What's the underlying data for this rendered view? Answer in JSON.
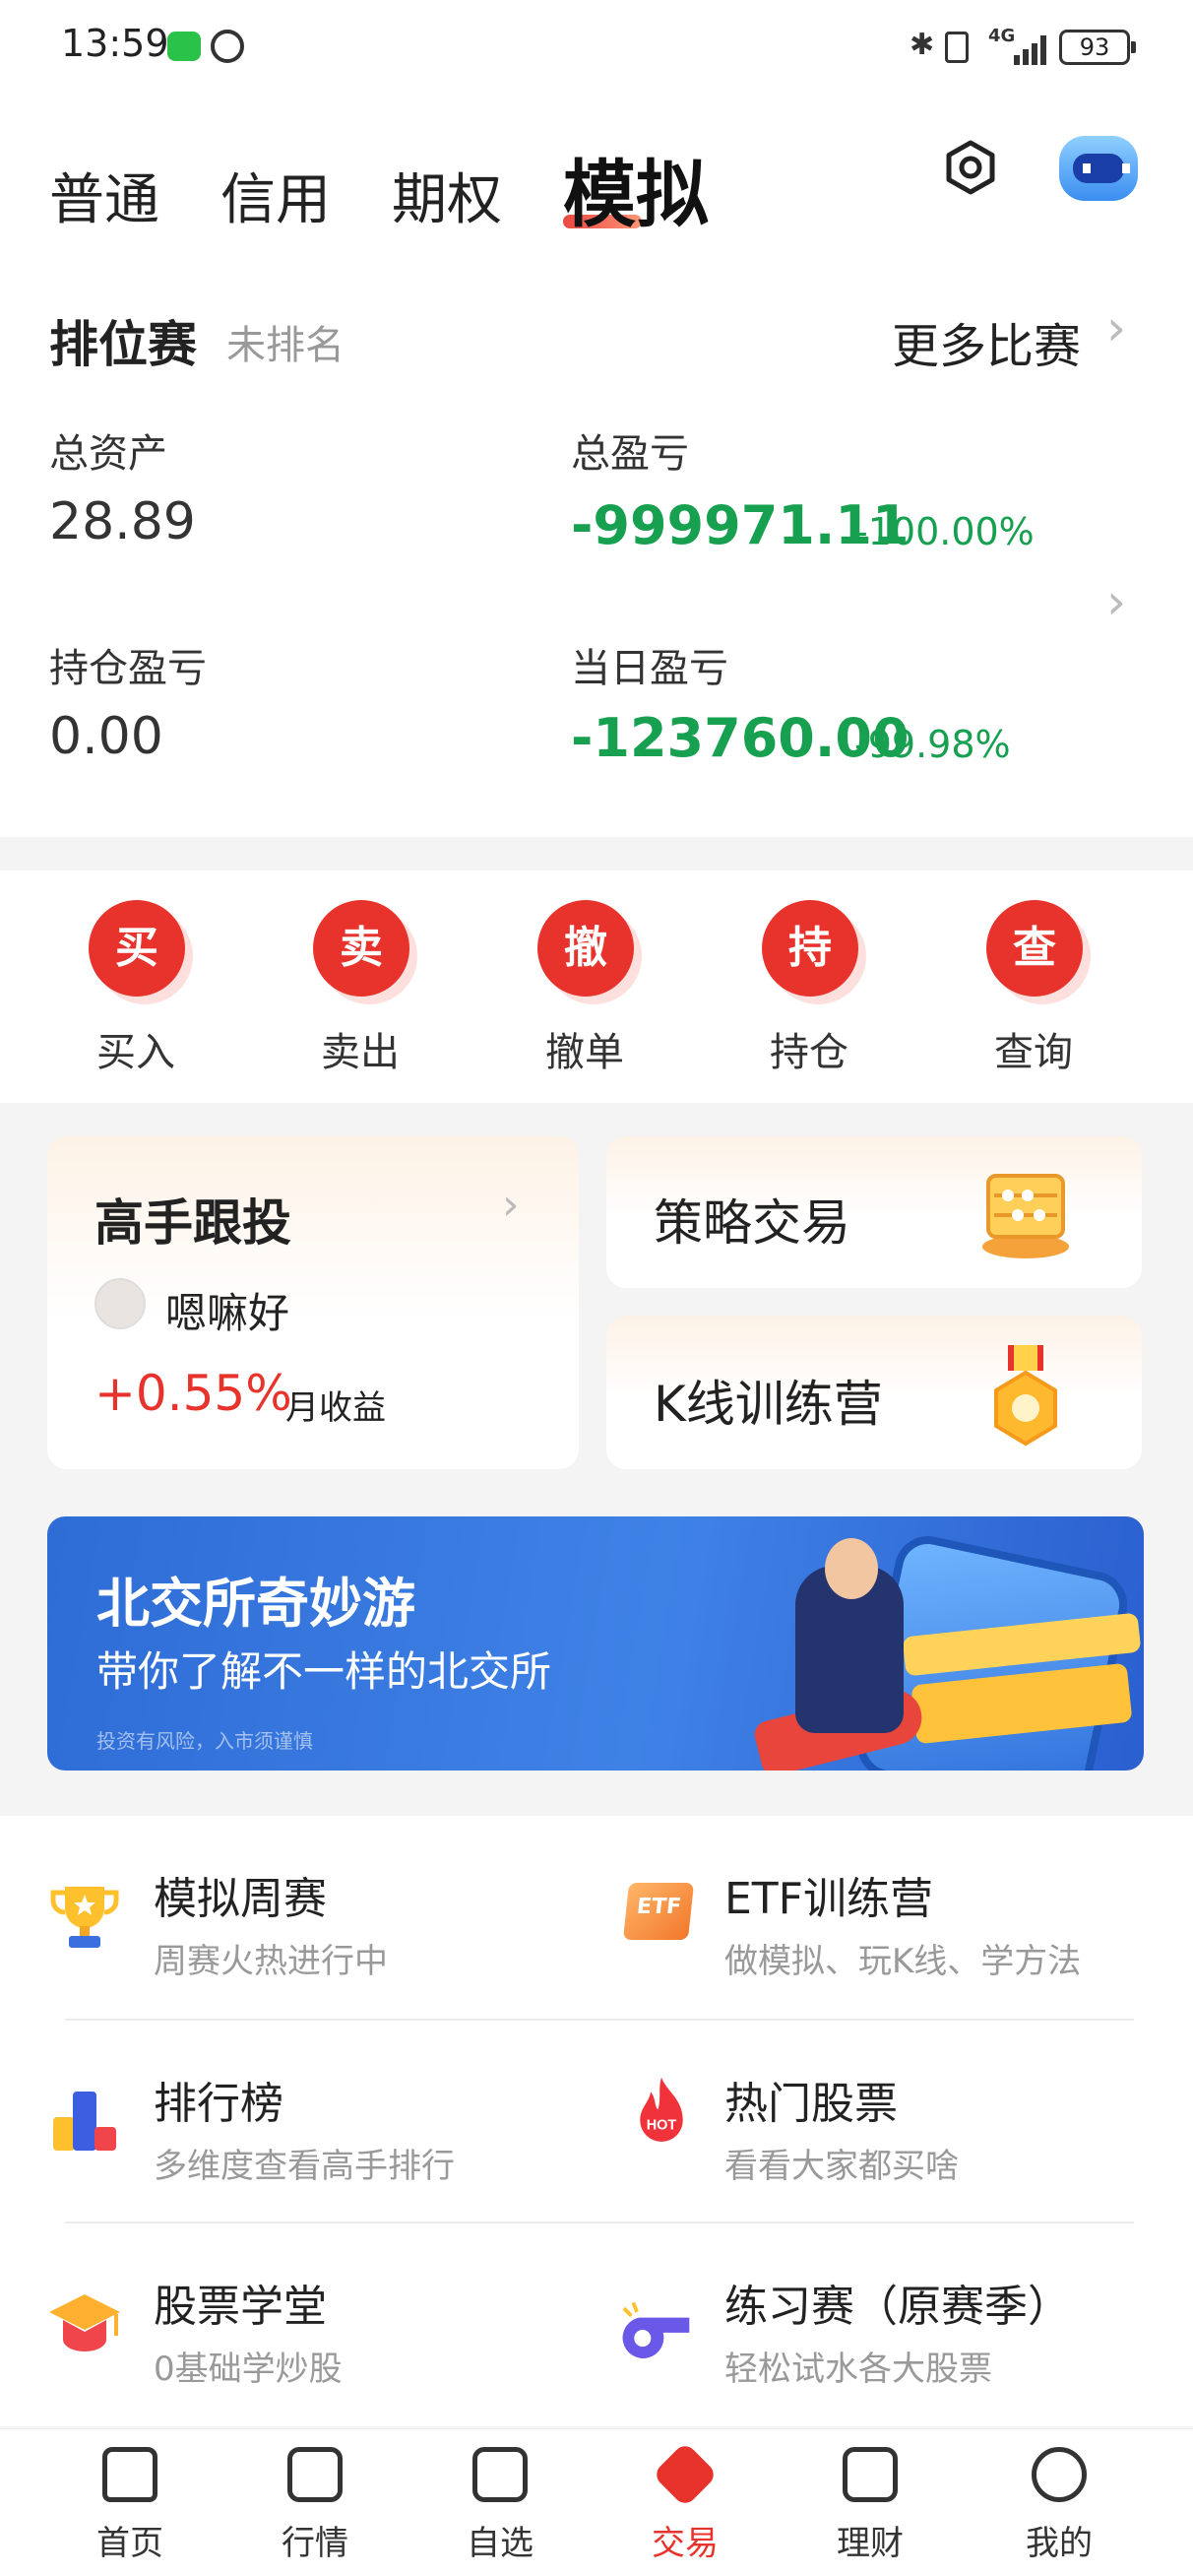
{
  "status_bar": {
    "time": "13:59",
    "network": "4G",
    "battery": "93"
  },
  "top_tabs": {
    "tab1": "普通",
    "tab2": "信用",
    "tab3": "期权",
    "active": "模拟"
  },
  "account": {
    "rank_title": "排位赛",
    "rank_status": "未排名",
    "more_matches": "更多比赛",
    "total_assets_label": "总资产",
    "total_assets": "28.89",
    "total_pnl_label": "总盈亏",
    "total_pnl": "-999971.11",
    "total_pnl_pct": "-100.00%",
    "position_pnl_label": "持仓盈亏",
    "position_pnl": "0.00",
    "day_pnl_label": "当日盈亏",
    "day_pnl": "-123760.00",
    "day_pnl_pct": "-99.98%"
  },
  "actions": [
    {
      "icon": "买",
      "label": "买入"
    },
    {
      "icon": "卖",
      "label": "卖出"
    },
    {
      "icon": "撤",
      "label": "撤单"
    },
    {
      "icon": "持",
      "label": "持仓"
    },
    {
      "icon": "查",
      "label": "查询"
    }
  ],
  "features": {
    "follow_title": "高手跟投",
    "follow_user": "嗯嘛好",
    "follow_return": "+0.55%",
    "follow_return_label": "月收益",
    "strategy": "策略交易",
    "kline": "K线训练营"
  },
  "banner": {
    "title": "北交所奇妙游",
    "subtitle": "带你了解不一样的北交所",
    "note": "投资有风险，入市须谨慎"
  },
  "list": [
    {
      "title": "模拟周赛",
      "subtitle": "周赛火热进行中",
      "icon": "trophy-icon"
    },
    {
      "title": "ETF训练营",
      "subtitle": "做模拟、玩K线、学方法",
      "icon": "etf-icon",
      "badge": "ETF"
    },
    {
      "title": "排行榜",
      "subtitle": "多维度查看高手排行",
      "icon": "ranking-icon"
    },
    {
      "title": "热门股票",
      "subtitle": "看看大家都买啥",
      "icon": "hot-icon",
      "badge": "HOT"
    },
    {
      "title": "股票学堂",
      "subtitle": "0基础学炒股",
      "icon": "graduation-cap-icon"
    },
    {
      "title": "练习赛（原赛季）",
      "subtitle": "轻松试水各大股票",
      "icon": "whistle-icon"
    }
  ],
  "tabbar": [
    "首页",
    "行情",
    "自选",
    "交易",
    "理财",
    "我的"
  ],
  "colors": {
    "accent": "#e8332c",
    "loss_green": "#17a050",
    "gain_red": "#e8332c"
  }
}
